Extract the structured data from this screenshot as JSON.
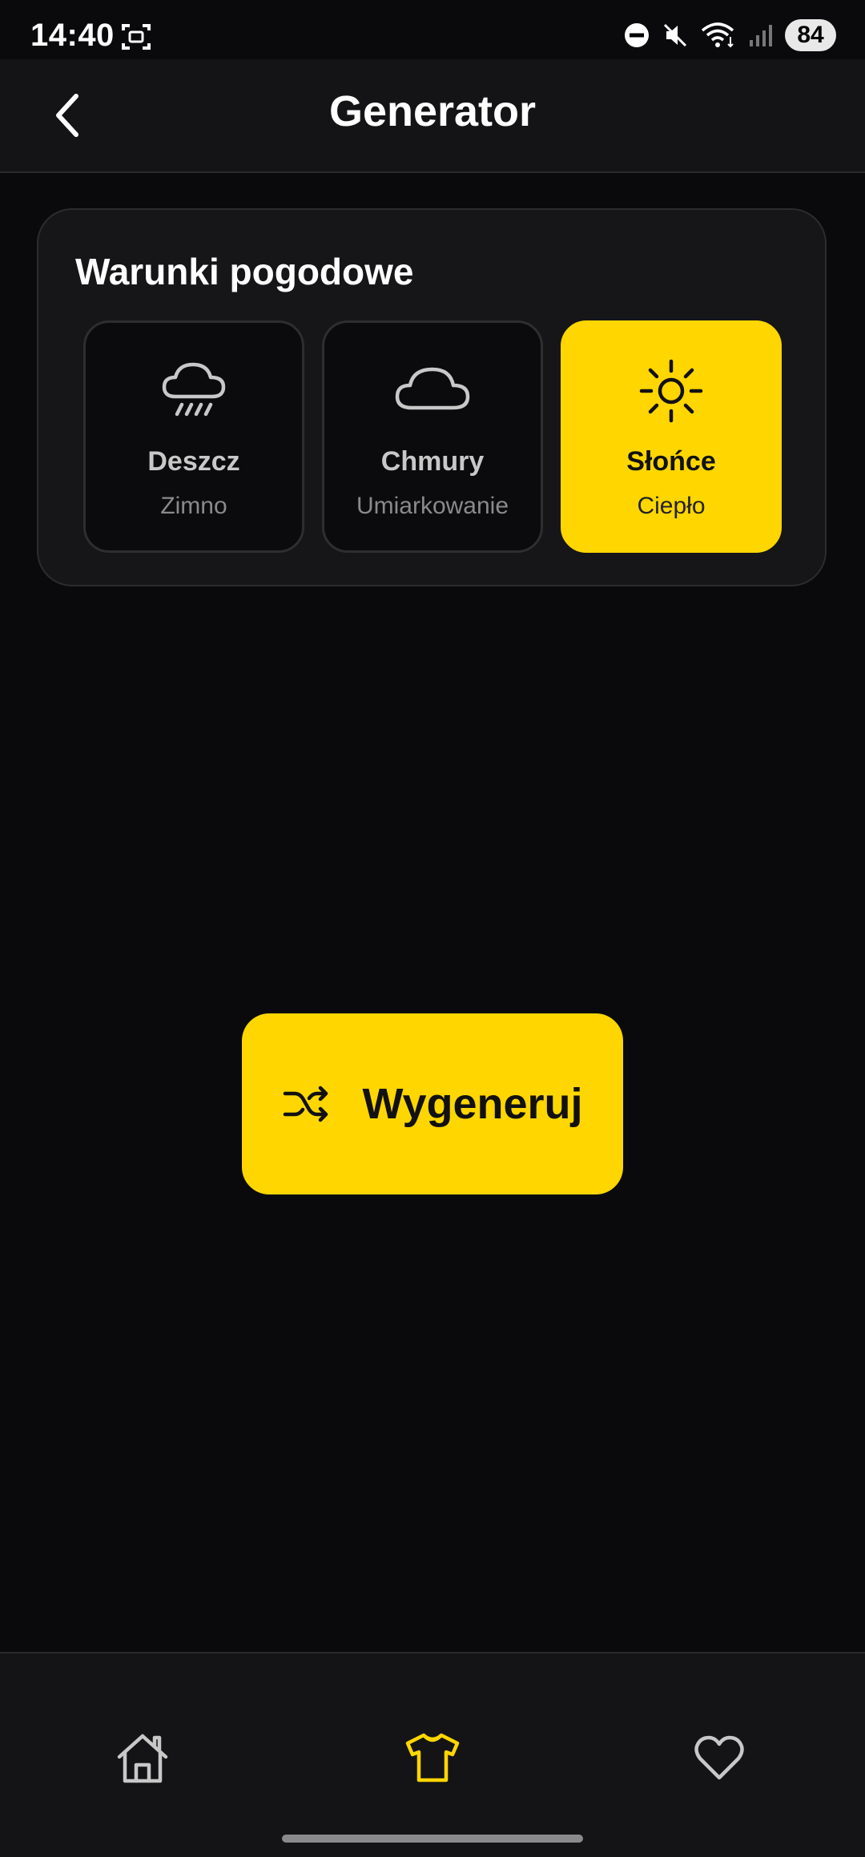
{
  "status_bar": {
    "time": "14:40",
    "battery": "84",
    "icons": [
      "screenshot-icon",
      "dnd-icon",
      "mute-icon",
      "wifi-icon",
      "signal-icon",
      "battery-icon"
    ]
  },
  "header": {
    "title": "Generator",
    "back_icon": "chevron-left-icon"
  },
  "weather": {
    "title": "Warunki pogodowe",
    "options": [
      {
        "label": "Deszcz",
        "sub": "Zimno",
        "icon": "rain-cloud-icon",
        "selected": false
      },
      {
        "label": "Chmury",
        "sub": "Umiarkowanie",
        "icon": "cloud-icon",
        "selected": false
      },
      {
        "label": "Słońce",
        "sub": "Ciepło",
        "icon": "sun-icon",
        "selected": true
      }
    ]
  },
  "generate": {
    "label": "Wygeneruj",
    "icon": "shuffle-icon"
  },
  "bottom_nav": {
    "items": [
      {
        "icon": "home-icon",
        "active": false
      },
      {
        "icon": "tshirt-icon",
        "active": true
      },
      {
        "icon": "heart-icon",
        "active": false
      }
    ]
  },
  "colors": {
    "accent": "#FFD600",
    "background": "#0A0A0C",
    "surface": "#161618",
    "inactive_icon": "#C8C8C8"
  }
}
